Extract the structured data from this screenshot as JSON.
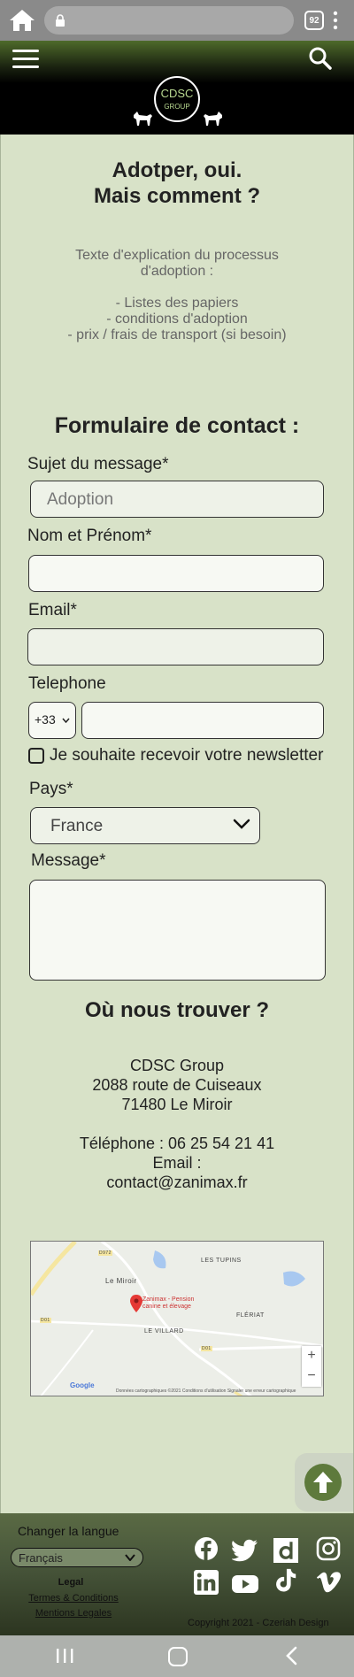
{
  "browser": {
    "tab_count": "92"
  },
  "header": {
    "logo_name": "CDSC",
    "logo_sub": "GROUP"
  },
  "intro": {
    "title_line1": "Adotper, oui.",
    "title_line2": "Mais comment ?",
    "text_line1": "Texte d'explication du processus",
    "text_line2": "d'adoption :",
    "list_item1": "- Listes des papiers",
    "list_item2": "- conditions d'adoption",
    "list_item3": "- prix / frais de transport (si besoin)"
  },
  "form": {
    "title": "Formulaire de contact :",
    "subject_label": "Sujet du message*",
    "subject_value": "Adoption",
    "name_label": "Nom et Prénom*",
    "email_label": "Email*",
    "phone_label": "Telephone",
    "phone_code": "+33",
    "newsletter_label": "Je souhaite recevoir votre newsletter",
    "country_label": "Pays*",
    "country_value": "France",
    "message_label": "Message*"
  },
  "location": {
    "title": "Où nous trouver ?",
    "company": "CDSC Group",
    "street": "2088 route de Cuiseaux",
    "city": "71480 Le Miroir",
    "phone": "Téléphone : 06 25 54 21 41",
    "email_label": "Email :",
    "email": "contact@zanimax.fr"
  },
  "map": {
    "label_tupins": "LES TUPINS",
    "label_miroir": "Le Miroir",
    "label_villard": "LE VILLARD",
    "label_fleriat": "FLÉRIAT",
    "road_d972": "D972",
    "road_d01": "D01",
    "road_d01b": "D01",
    "pin_line1": "Zanimax - Pension",
    "pin_line2": "canine et élevage",
    "zoom_in": "+",
    "zoom_out": "−",
    "google": "Google",
    "footer": "Données cartographiques ©2021    Conditions d'utilisation    Signaler une erreur cartographique"
  },
  "footer": {
    "lang_label": "Changer la langue",
    "lang_value": "Français",
    "legal_head": "Legal",
    "terms": "Termes & Conditions",
    "mentions": "Mentions Legales",
    "copyright": "Copyright 2021 - Czeriah Design"
  },
  "colors": {
    "page_bg": "#d8e2c8",
    "accent_green": "#5e7a3c",
    "footer_green": "#47553a"
  }
}
